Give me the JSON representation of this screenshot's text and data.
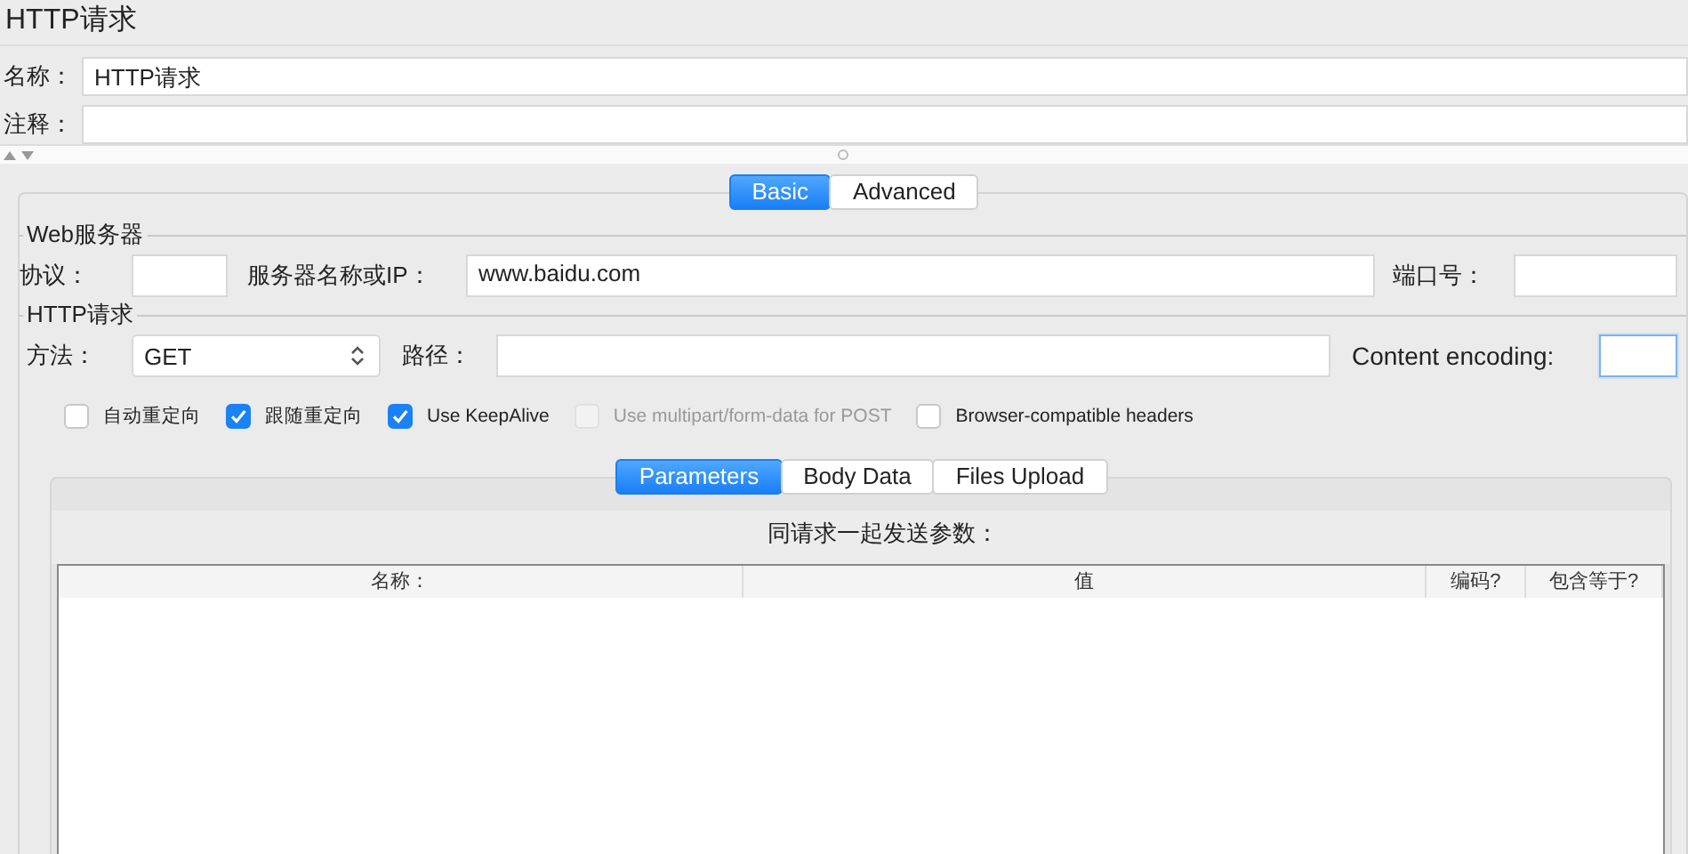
{
  "title": "HTTP请求",
  "name_field": {
    "label": "名称：",
    "value": "HTTP请求"
  },
  "comment_field": {
    "label": "注释："
  },
  "tabs": [
    {
      "label": "Basic",
      "selected": true
    },
    {
      "label": "Advanced",
      "selected": false
    }
  ],
  "web_server": {
    "legend": "Web服务器",
    "protocol": {
      "label": "协议："
    },
    "server": {
      "label": "服务器名称或IP：",
      "value": "www.baidu.com"
    },
    "port": {
      "label": "端口号："
    }
  },
  "http_request": {
    "legend": "HTTP请求",
    "method": {
      "label": "方法：",
      "value": "GET"
    },
    "path": {
      "label": "路径："
    },
    "content_encoding": {
      "label": "Content encoding:",
      "focused": true
    },
    "options": [
      {
        "label": "自动重定向",
        "checked": false,
        "disabled": false
      },
      {
        "label": "跟随重定向",
        "checked": true,
        "disabled": false
      },
      {
        "label": "Use KeepAlive",
        "checked": true,
        "disabled": false
      },
      {
        "label": "Use multipart/form-data for POST",
        "checked": false,
        "disabled": true
      },
      {
        "label": "Browser-compatible headers",
        "checked": false,
        "disabled": false
      }
    ]
  },
  "sub_tabs": [
    {
      "label": "Parameters",
      "selected": true
    },
    {
      "label": "Body Data",
      "selected": false
    },
    {
      "label": "Files Upload",
      "selected": false
    }
  ],
  "parameters": {
    "caption": "同请求一起发送参数：",
    "columns": [
      "名称：",
      "值",
      "编码?",
      "包含等于?"
    ]
  }
}
